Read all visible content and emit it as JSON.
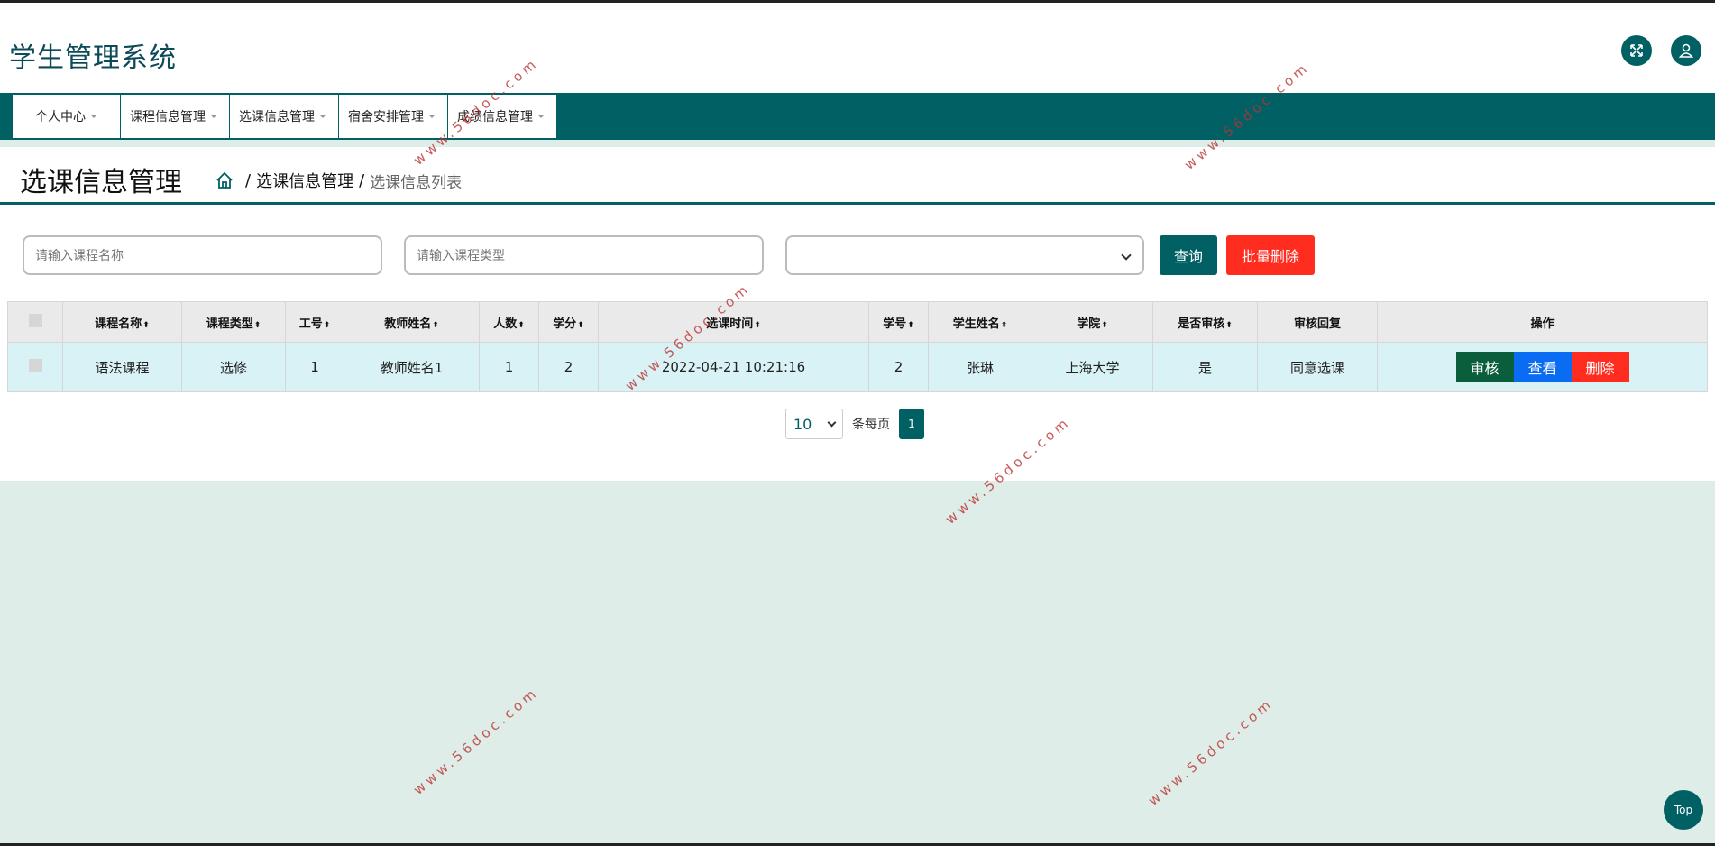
{
  "app": {
    "title": "学生管理系统"
  },
  "header": {
    "fullscreen_icon": "fullscreen-icon",
    "user_icon": "user-icon"
  },
  "nav": {
    "items": [
      {
        "label": "个人中心"
      },
      {
        "label": "课程信息管理"
      },
      {
        "label": "选课信息管理"
      },
      {
        "label": "宿舍安排管理"
      },
      {
        "label": "成绩信息管理"
      }
    ]
  },
  "page": {
    "title": "选课信息管理",
    "breadcrumb": {
      "section": "选课信息管理",
      "current": "选课信息列表",
      "sep": "/"
    }
  },
  "filters": {
    "course_name_placeholder": "请输入课程名称",
    "course_type_placeholder": "请输入课程类型",
    "select_value": "",
    "query_label": "查询",
    "batch_delete_label": "批量删除"
  },
  "table": {
    "headers": [
      "课程名称",
      "课程类型",
      "工号",
      "教师姓名",
      "人数",
      "学分",
      "选课时间",
      "学号",
      "学生姓名",
      "学院",
      "是否审核",
      "审核回复",
      "操作"
    ],
    "rows": [
      {
        "course_name": "语法课程",
        "course_type": "选修",
        "staff_no": "1",
        "teacher_name": "教师姓名1",
        "count": "1",
        "credit": "2",
        "select_time": "2022-04-21 10:21:16",
        "student_no": "2",
        "student_name": "张琳",
        "college": "上海大学",
        "reviewed": "是",
        "reply": "同意选课",
        "actions": {
          "review": "审核",
          "view": "查看",
          "delete": "删除"
        }
      }
    ]
  },
  "pagination": {
    "page_size": "10",
    "page_size_label": "条每页",
    "current_page": "1"
  },
  "top_button": {
    "label": "Top"
  },
  "watermark": "www.56doc.com",
  "colors": {
    "primary": "#006064",
    "danger": "#ff2d20",
    "info": "#0a6cf2",
    "review": "#0b5e3c"
  }
}
